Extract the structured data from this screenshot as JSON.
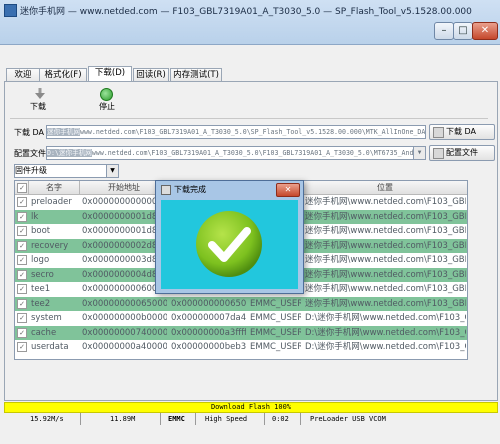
{
  "window": {
    "title": "迷你手机网 — www.netded.com — F103_GBL7319A01_A_T3030_5.0 — SP_Flash_Tool_v5.1528.00.000",
    "min_label": "–",
    "max_label": "□",
    "close_label": "✕"
  },
  "tabs": [
    "欢迎(W)",
    "格式化(F)",
    "下载(D)",
    "回读(R)",
    "内存测试(T)"
  ],
  "toolbar": {
    "download_label": "下载",
    "stop_label": "停止"
  },
  "form": {
    "da_label": "下载 DA",
    "da_path_prefix": "迷你手机网",
    "da_path_rest": "www.netded.com\\F103_GBL7319A01_A_T3030_5.0\\SP_Flash_Tool_v5.1528.00.000\\MTK_AllInOne_DA.bin",
    "da_button": "下载 DA",
    "scatter_label": "配置文件",
    "scatter_path_prefix": "D:\\迷你手机网",
    "scatter_path_rest": "www.netded.com\\F103_GBL7319A01_A_T3030_5.0\\F103_GBL7319A01_A_T3030_5.0\\MT6735_Android_",
    "scatter_button": "配置文件",
    "mode_value": "固件升级"
  },
  "table": {
    "headers": [
      "",
      "名字",
      "开始地址",
      "",
      "",
      "位置"
    ],
    "rows": [
      {
        "name": "preloader",
        "start": "0x0000000000000000",
        "end": "",
        "region": "",
        "location": "迷你手机网\\www.netded.com\\F103_GBL7319..."
      },
      {
        "name": "lk",
        "start": "0x0000000001d80000",
        "end": "",
        "region": "",
        "location": "迷你手机网\\www.netded.com\\F103_GBL7319..."
      },
      {
        "name": "boot",
        "start": "0x0000000001d80000",
        "end": "",
        "region": "",
        "location": "迷你手机网\\www.netded.com\\F103_GBL7319..."
      },
      {
        "name": "recovery",
        "start": "0x0000000002d80000",
        "end": "",
        "region": "",
        "location": "迷你手机网\\www.netded.com\\F103_GBL7319..."
      },
      {
        "name": "logo",
        "start": "0x0000000003d80000",
        "end": "",
        "region": "",
        "location": "迷你手机网\\www.netded.com\\F103_GBL7319..."
      },
      {
        "name": "secro",
        "start": "0x0000000004d80000",
        "end": "",
        "region": "",
        "location": "迷你手机网\\www.netded.com\\F103_GBL7319..."
      },
      {
        "name": "tee1",
        "start": "0x0000000006000000",
        "end": "",
        "region": "",
        "location": "迷你手机网\\www.netded.com\\F103_GBL7319..."
      },
      {
        "name": "tee2",
        "start": "0x0000000006500000",
        "end": "0x000000000650ff",
        "region": "EMMC_USER",
        "location": "迷你手机网\\www.netded.com\\F103_GBL7319..."
      },
      {
        "name": "system",
        "start": "0x000000000b000000",
        "end": "0x000000007da440ff",
        "region": "EMMC_USER",
        "location": "D:\\迷你手机网\\www.netded.com\\F103_GBL7319..."
      },
      {
        "name": "cache",
        "start": "0x0000000074000000",
        "end": "0x00000000a3ffffff",
        "region": "EMMC_USER",
        "location": "D:\\迷你手机网\\www.netded.com\\F103_GBL7319..."
      },
      {
        "name": "userdata",
        "start": "0x00000000a4000000",
        "end": "0x00000000beb33453",
        "region": "EMMC_USER",
        "location": "D:\\迷你手机网\\www.netded.com\\F103_GBL7319..."
      }
    ]
  },
  "status": {
    "progress_text": "Download Flash 100%",
    "progress_percent": 100,
    "speed": "15.92M/s",
    "size": "11.89M",
    "storage": "EMMC",
    "usb_speed": "High Speed",
    "time": "0:02",
    "port": "PreLoader USB VCOM"
  },
  "dialog": {
    "title": "下载完成",
    "close_label": "✕"
  },
  "colors": {
    "accent_row": "#80c39a",
    "progress": "#ffff00",
    "dialog_body": "#22c7dd",
    "success": "#7dc11f"
  }
}
